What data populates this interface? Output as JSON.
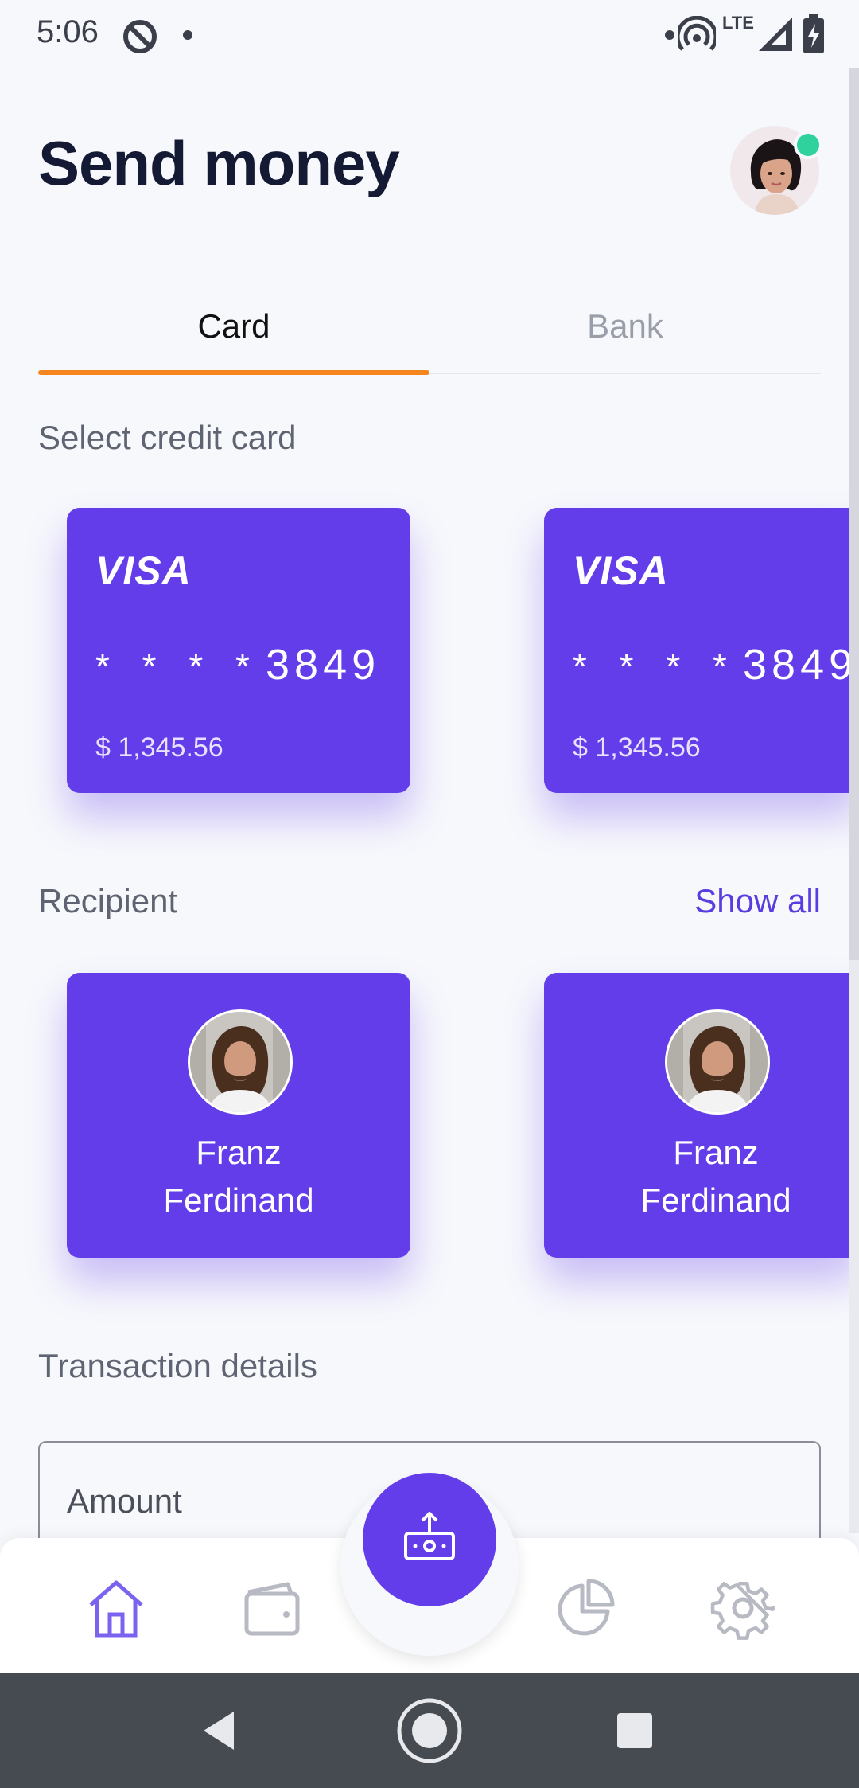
{
  "status_bar": {
    "time": "5:06",
    "network": "LTE",
    "icons": [
      "do-not-disturb-icon",
      "notification-dot-icon",
      "hotspot-icon",
      "signal-icon",
      "battery-charging-icon"
    ]
  },
  "header": {
    "title": "Send money",
    "avatar_status": "online"
  },
  "tabs": [
    {
      "label": "Card",
      "active": true
    },
    {
      "label": "Bank",
      "active": false
    }
  ],
  "credit_cards": {
    "section_label": "Select credit card",
    "cards": [
      {
        "brand": "VISA",
        "masked": "* * * *",
        "last4": "3849",
        "balance": "$ 1,345.56"
      },
      {
        "brand": "VISA",
        "masked": "* * * *",
        "last4": "3849",
        "balance": "$ 1,345.56"
      }
    ]
  },
  "recipients": {
    "section_label": "Recipient",
    "show_all_label": "Show all",
    "items": [
      {
        "first_name": "Franz",
        "last_name": "Ferdinand"
      },
      {
        "first_name": "Franz",
        "last_name": "Ferdinand"
      }
    ]
  },
  "transaction": {
    "section_label": "Transaction details",
    "amount_label": "Amount"
  },
  "bottom_nav": {
    "items": [
      "home-icon",
      "wallet-icon",
      "send-money-icon",
      "pie-chart-icon",
      "settings-icon"
    ],
    "active": "home-icon"
  },
  "system_nav": [
    "back-icon",
    "home-circle-icon",
    "recents-icon"
  ],
  "colors": {
    "primary": "#623de9",
    "accent_tab": "#f5861f",
    "online": "#2fd19c",
    "background": "#f7f8fc"
  }
}
